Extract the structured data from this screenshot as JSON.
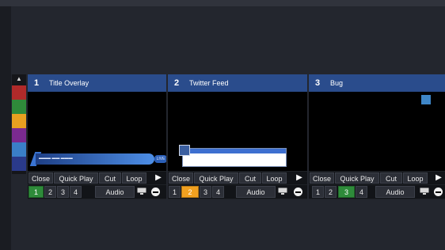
{
  "colors": {
    "header": "#2a4c8c",
    "active_green": "#2e8b3a",
    "active_orange": "#f0a020",
    "swatches": [
      "#b02a2a",
      "#2f8a3a",
      "#e8a020",
      "#7a2a90",
      "#3a7fc8",
      "#2a3a8a"
    ]
  },
  "labels": {
    "close": "Close",
    "quick_play": "Quick Play",
    "cut": "Cut",
    "loop": "Loop",
    "audio": "Audio"
  },
  "inputs": [
    {
      "number": "1",
      "title": "Title Overlay",
      "active_overlay": "1",
      "active_color": "green"
    },
    {
      "number": "2",
      "title": "Twitter Feed",
      "active_overlay": "2",
      "active_color": "orange"
    },
    {
      "number": "3",
      "title": "Bug",
      "active_overlay": "3",
      "active_color": "green"
    }
  ],
  "overlay_numbers": [
    "1",
    "2",
    "3",
    "4"
  ],
  "previews": {
    "title_overlay_tag": "LIVE"
  }
}
